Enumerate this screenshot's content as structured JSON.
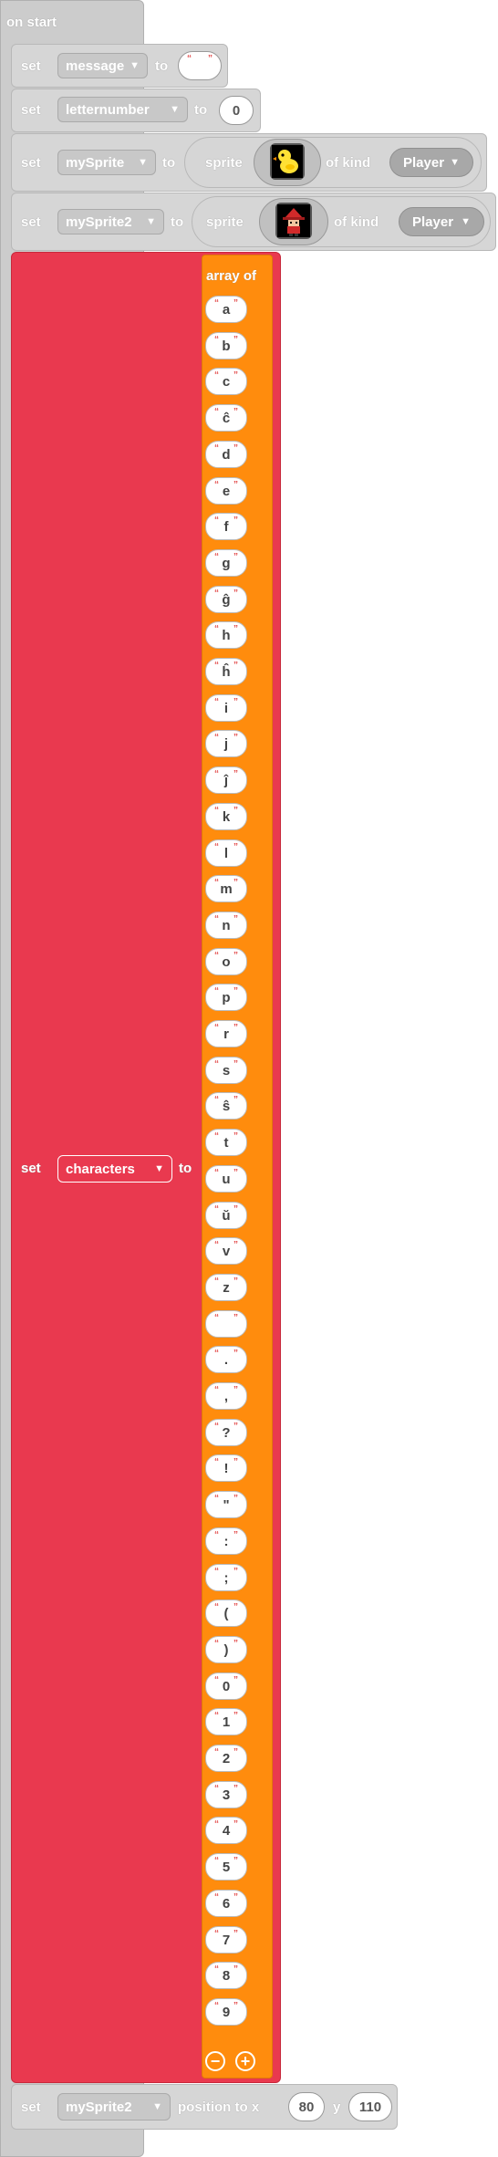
{
  "colors": {
    "event_block": "#cccccc",
    "set_block": "#d6d6d6",
    "array_variable_block": "#e9394f",
    "array_block": "#ff8c0d"
  },
  "event": {
    "label": "on start"
  },
  "rows": [
    {
      "set": "set",
      "variable": "message",
      "to": "to",
      "value": ""
    },
    {
      "set": "set",
      "variable": "letternumber",
      "to": "to",
      "value": "0"
    },
    {
      "set": "set",
      "variable": "mySprite",
      "to": "to",
      "sprite_label": "sprite",
      "sprite_icon": "duck-sprite-icon",
      "of_kind": "of kind",
      "kind": "Player"
    },
    {
      "set": "set",
      "variable": "mySprite2",
      "to": "to",
      "sprite_label": "sprite",
      "sprite_icon": "red-hat-character-sprite-icon",
      "of_kind": "of kind",
      "kind": "Player"
    }
  ],
  "characters_block": {
    "set": "set",
    "variable": "characters",
    "to": "to",
    "array_label": "array of",
    "items": [
      "a",
      "b",
      "c",
      "ĉ",
      "d",
      "e",
      "f",
      "g",
      "ĝ",
      "h",
      "ĥ",
      "i",
      "j",
      "ĵ",
      "k",
      "l",
      "m",
      "n",
      "o",
      "p",
      "r",
      "s",
      "ŝ",
      "t",
      "u",
      "ŭ",
      "v",
      "z",
      " ",
      ".",
      ",",
      "?",
      "!",
      "\"",
      ":",
      ";",
      "(",
      ")",
      "0",
      "1",
      "2",
      "3",
      "4",
      "5",
      "6",
      "7",
      "8",
      "9"
    ],
    "remove_button": "−",
    "add_button": "+"
  },
  "position_block": {
    "set": "set",
    "variable": "mySprite2",
    "position_label": "position to x",
    "x": "80",
    "y_label": "y",
    "y": "110"
  }
}
